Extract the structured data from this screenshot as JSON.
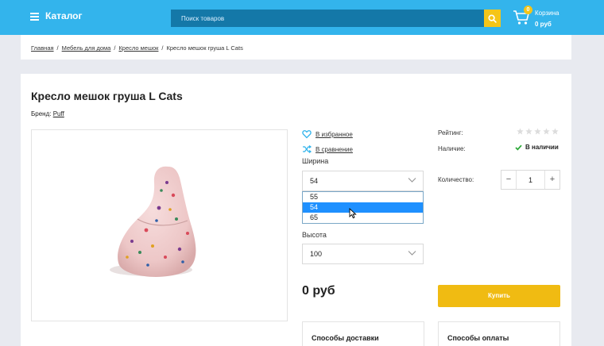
{
  "header": {
    "catalog_label": "Каталог",
    "search_placeholder": "Поиск товаров",
    "cart": {
      "label": "Корзина",
      "total": "0 руб",
      "count": "0"
    }
  },
  "breadcrumbs": [
    {
      "label": "Главная",
      "link": true
    },
    {
      "label": "Мебель для дома",
      "link": true
    },
    {
      "label": "Кресло мешок",
      "link": true
    },
    {
      "label": "Кресло мешок груша L Cats",
      "link": false
    }
  ],
  "product": {
    "title": "Кресло мешок груша L Cats",
    "brand_label": "Бренд:",
    "brand_value": "Puff",
    "favorite_label": "В избранное",
    "compare_label": "В сравнение",
    "width": {
      "label": "Ширина",
      "selected": "54",
      "options": [
        "55",
        "54",
        "65"
      ],
      "highlighted": "54"
    },
    "height": {
      "label": "Высота",
      "selected": "100"
    },
    "price": "0 руб",
    "rating_label": "Рейтинг:",
    "rating_value": 0,
    "rating_max": 5,
    "availability_label": "Наличие:",
    "availability_value": "В наличии",
    "quantity_label": "Количество:",
    "quantity_value": "1",
    "buy_label": "Купить",
    "delivery_title": "Способы доставки",
    "payment_title": "Способы оплаты"
  },
  "colors": {
    "header_bg": "#33b4ec",
    "accent": "#f0bb12",
    "in_stock": "#2eaa3a",
    "highlight": "#1e90ff"
  }
}
